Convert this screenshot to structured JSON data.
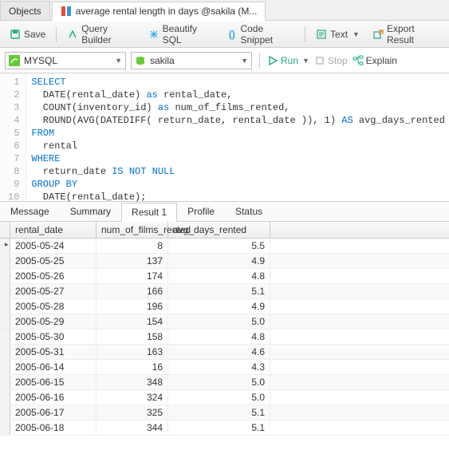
{
  "tabs_top": {
    "objects": "Objects",
    "query": "average rental length in days @sakila (M..."
  },
  "toolbar": {
    "save": "Save",
    "query_builder": "Query Builder",
    "beautify": "Beautify SQL",
    "snippet": "Code Snippet",
    "text": "Text",
    "export": "Export Result"
  },
  "row2": {
    "engine": "MYSQL",
    "db": "sakila",
    "run": "Run",
    "stop": "Stop",
    "explain": "Explain"
  },
  "code": {
    "l1": "SELECT",
    "l2a": "  DATE(rental_date) ",
    "l2b": "as",
    "l2c": " rental_date,",
    "l3a": "  COUNT(inventory_id) ",
    "l3b": "as",
    "l3c": " num_of_films_rented,",
    "l4a": "  ROUND(AVG(DATEDIFF( return_date, rental_date )), 1) ",
    "l4b": "AS",
    "l4c": " avg_days_rented",
    "l5": "FROM",
    "l6": "  rental",
    "l7": "WHERE",
    "l8a": "  return_date ",
    "l8b": "IS NOT NULL",
    "l9": "GROUP BY",
    "l10": "  DATE(rental_date);"
  },
  "midtabs": {
    "message": "Message",
    "summary": "Summary",
    "result1": "Result 1",
    "profile": "Profile",
    "status": "Status"
  },
  "grid": {
    "headers": {
      "c1": "rental_date",
      "c2": "num_of_films_rented",
      "c3": "avg_days_rented"
    },
    "rows": [
      {
        "c1": "2005-05-24",
        "c2": "8",
        "c3": "5.5"
      },
      {
        "c1": "2005-05-25",
        "c2": "137",
        "c3": "4.9"
      },
      {
        "c1": "2005-05-26",
        "c2": "174",
        "c3": "4.8"
      },
      {
        "c1": "2005-05-27",
        "c2": "166",
        "c3": "5.1"
      },
      {
        "c1": "2005-05-28",
        "c2": "196",
        "c3": "4.9"
      },
      {
        "c1": "2005-05-29",
        "c2": "154",
        "c3": "5.0"
      },
      {
        "c1": "2005-05-30",
        "c2": "158",
        "c3": "4.8"
      },
      {
        "c1": "2005-05-31",
        "c2": "163",
        "c3": "4.6"
      },
      {
        "c1": "2005-06-14",
        "c2": "16",
        "c3": "4.3"
      },
      {
        "c1": "2005-06-15",
        "c2": "348",
        "c3": "5.0"
      },
      {
        "c1": "2005-06-16",
        "c2": "324",
        "c3": "5.0"
      },
      {
        "c1": "2005-06-17",
        "c2": "325",
        "c3": "5.1"
      },
      {
        "c1": "2005-06-18",
        "c2": "344",
        "c3": "5.1"
      }
    ]
  }
}
